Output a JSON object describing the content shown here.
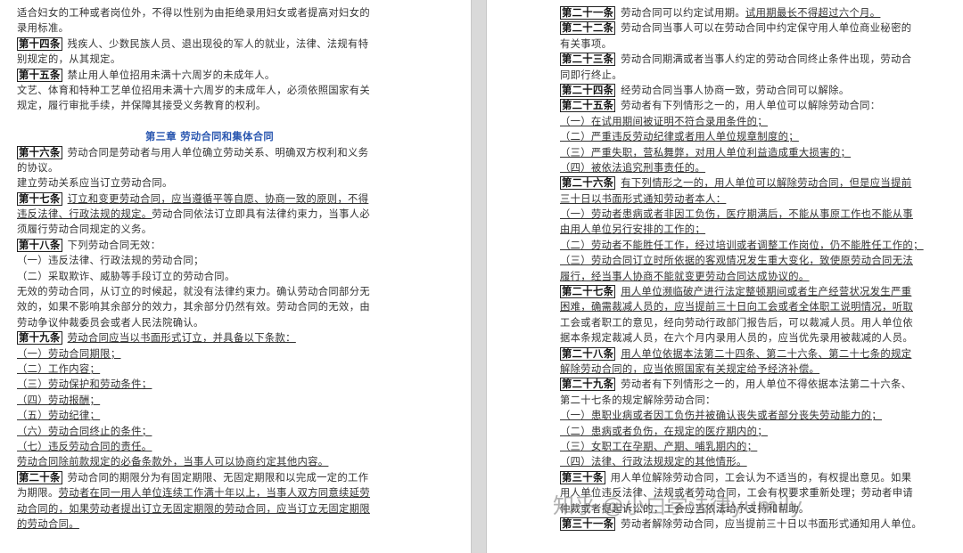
{
  "left_page": {
    "lines": [
      {
        "h": "",
        "t": "适合妇女的工种或者岗位外，不得以性别为由拒绝录用妇女或者提高对妇女的"
      },
      {
        "h": "",
        "t": "录用标准。"
      },
      {
        "h": "第十四条",
        "t": "残疾人、少数民族人员、退出现役的军人的就业，法律、法规有特"
      },
      {
        "h": "",
        "t": "别规定的，从其规定。"
      },
      {
        "h": "第十五条",
        "t": "禁止用人单位招用未满十六周岁的未成年人。"
      },
      {
        "h": "",
        "t": "文艺、体育和特种工艺单位招用未满十六周岁的未成年人，必须依照国家有关"
      },
      {
        "h": "",
        "t": "规定，履行审批手续，并保障其接受义务教育的权利。"
      },
      {
        "blank": true
      },
      {
        "chapter": "第三章 劳动合同和集体合同"
      },
      {
        "h": "第十六条",
        "t": "劳动合同是劳动者与用人单位确立劳动关系、明确双方权利和义务"
      },
      {
        "h": "",
        "t": "的协议。"
      },
      {
        "h": "",
        "t": "建立劳动关系应当订立劳动合同。"
      },
      {
        "h": "第十七条",
        "t": "订立和变更劳动合同，应当遵循平等自愿、协商一致的原则，不得",
        "u": true
      },
      {
        "h": "",
        "t": "违反法律、行政法规的规定。",
        "u": true,
        "rest": "劳动合同依法订立即具有法律约束力，当事人必"
      },
      {
        "h": "",
        "t": "须履行劳动合同规定的义务。"
      },
      {
        "h": "第十八条",
        "t": "下列劳动合同无效："
      },
      {
        "h": "",
        "t": "（一）违反法律、行政法规的劳动合同；"
      },
      {
        "h": "",
        "t": "（二）采取欺诈、威胁等手段订立的劳动合同。"
      },
      {
        "h": "",
        "t": "无效的劳动合同，从订立的时候起，就没有法律约束力。确认劳动合同部分无"
      },
      {
        "h": "",
        "t": "效的，如果不影响其余部分的效力，其余部分仍然有效。劳动合同的无效，由"
      },
      {
        "h": "",
        "t": "劳动争议仲裁委员会或者人民法院确认。"
      },
      {
        "h": "第十九条",
        "t": "劳动合同应当以书面形式订立，并具备以下条款：",
        "u": true
      },
      {
        "h": "",
        "t": "（一）劳动合同期限；",
        "u": true
      },
      {
        "h": "",
        "t": "（二）工作内容；",
        "u": true
      },
      {
        "h": "",
        "t": "（三）劳动保护和劳动条件；",
        "u": true
      },
      {
        "h": "",
        "t": "（四）劳动报酬；",
        "u": true
      },
      {
        "h": "",
        "t": "（五）劳动纪律；",
        "u": true
      },
      {
        "h": "",
        "t": "（六）劳动合同终止的条件；",
        "u": true
      },
      {
        "h": "",
        "t": "（七）违反劳动合同的责任。",
        "u": true
      },
      {
        "h": "",
        "t": "劳动合同除前款规定的必备条款外，当事人可以协商约定其他内容。",
        "u": true
      },
      {
        "h": "第二十条",
        "t": "劳动合同的期限分为有固定期限、无固定期限和以完成一定的工作"
      },
      {
        "h": "",
        "t": "为期限。",
        "rest2": "劳动者在同一用人单位连续工作满十年以上，当事人双方同意续延劳"
      },
      {
        "h": "",
        "t": "动合同的，如果劳动者提出订立无固定期限的劳动合同，应当订立无固定期限",
        "u": true
      },
      {
        "h": "",
        "t": "的劳动合同。",
        "u": true
      }
    ]
  },
  "right_page": {
    "lines": [
      {
        "h": "第二十一条",
        "t": "劳动合同可以约定试用期。",
        "rest": "试用期最长不得超过六个月。",
        "ru": true
      },
      {
        "h": "第二十二条",
        "t": "劳动合同当事人可以在劳动合同中约定保守用人单位商业秘密的"
      },
      {
        "h": "",
        "t": "有关事项。"
      },
      {
        "h": "第二十三条",
        "t": "劳动合同期满或者当事人约定的劳动合同终止条件出现，劳动合"
      },
      {
        "h": "",
        "t": "同即行终止。"
      },
      {
        "h": "第二十四条",
        "t": "经劳动合同当事人协商一致，劳动合同可以解除。"
      },
      {
        "h": "第二十五条",
        "t": "劳动者有下列情形之一的，用人单位可以解除劳动合同："
      },
      {
        "h": "",
        "t": "（一）在试用期间被证明不符合录用条件的；",
        "u": true
      },
      {
        "h": "",
        "t": "（二）严重违反劳动纪律或者用人单位规章制度的；",
        "u": true
      },
      {
        "h": "",
        "t": "（三）严重失职，营私舞弊，对用人单位利益造成重大损害的；",
        "u": true
      },
      {
        "h": "",
        "t": "（四）被依法追究刑事责任的。",
        "u": true
      },
      {
        "h": "第二十六条",
        "t": "有下列情形之一的，用人单位可以解除劳动合同，但是应当提前",
        "u": true
      },
      {
        "h": "",
        "t": "三十日以书面形式通知劳动者本人：",
        "u": true
      },
      {
        "h": "",
        "t": "（一）劳动者患病或者非因工负伤，医疗期满后，不能从事原工作也不能从事",
        "u": true
      },
      {
        "h": "",
        "t": "由用人单位另行安排的工作的；",
        "u": true
      },
      {
        "h": "",
        "t": "（二）劳动者不能胜任工作，经过培训或者调整工作岗位，仍不能胜任工作的；",
        "u": true
      },
      {
        "h": "",
        "t": "（三）劳动合同订立时所依据的客观情况发生重大变化，致使原劳动合同无法",
        "u": true
      },
      {
        "h": "",
        "t": "履行，经当事人协商不能就变更劳动合同达成协议的。",
        "u": true
      },
      {
        "h": "第二十七条",
        "t": "用人单位濒临破产进行法定整顿期间或者生产经营状况发生严重",
        "u": true
      },
      {
        "h": "",
        "t": "困难，确需裁减人员的，应当提前三十日向工会或者全体职工说明情况，听取",
        "u": true
      },
      {
        "h": "",
        "t": "工会或者职工的意见，经向劳动行政部门报告后，可以裁减人员。用人单位依"
      },
      {
        "h": "",
        "t": "据本条规定裁减人员，在六个月内录用人员的，应当优先录用被裁减的人员。"
      },
      {
        "h": "第二十八条",
        "t": "用人单位依据本法第二十四条、第二十六条、第二十七条的规定",
        "u": true
      },
      {
        "h": "",
        "t": "解除劳动合同的，应当依照国家有关规定给予经济补偿。",
        "u": true
      },
      {
        "h": "第二十九条",
        "t": "劳动者有下列情形之一的，用人单位不得依据本法第二十六条、"
      },
      {
        "h": "",
        "t": "第二十七条的规定解除劳动合同："
      },
      {
        "h": "",
        "t": "（一）患职业病或者因工负伤并被确认丧失或者部分丧失劳动能力的；",
        "u": true
      },
      {
        "h": "",
        "t": "（二）患病或者负伤，在规定的医疗期内的；",
        "u": true
      },
      {
        "h": "",
        "t": "（三）女职工在孕期、产期、哺乳期内的；",
        "u": true
      },
      {
        "h": "",
        "t": "（四）法律、行政法规规定的其他情形。",
        "u": true
      },
      {
        "h": "第三十条",
        "t": "用人单位解除劳动合同，工会认为不适当的，有权提出意见。如果"
      },
      {
        "h": "",
        "t": "用人单位违反法律、法规或者劳动合同，工会有权要求重新处理；劳动者申请"
      },
      {
        "h": "",
        "t": "仲裁或者提起诉讼的，工会应当依法给予支持和帮助。"
      },
      {
        "h": "第三十一条",
        "t": "劳动者解除劳动合同，应当提前三十日以书面形式通知用人单位。"
      }
    ]
  },
  "watermark": "知乎 @小白学法律yumily"
}
